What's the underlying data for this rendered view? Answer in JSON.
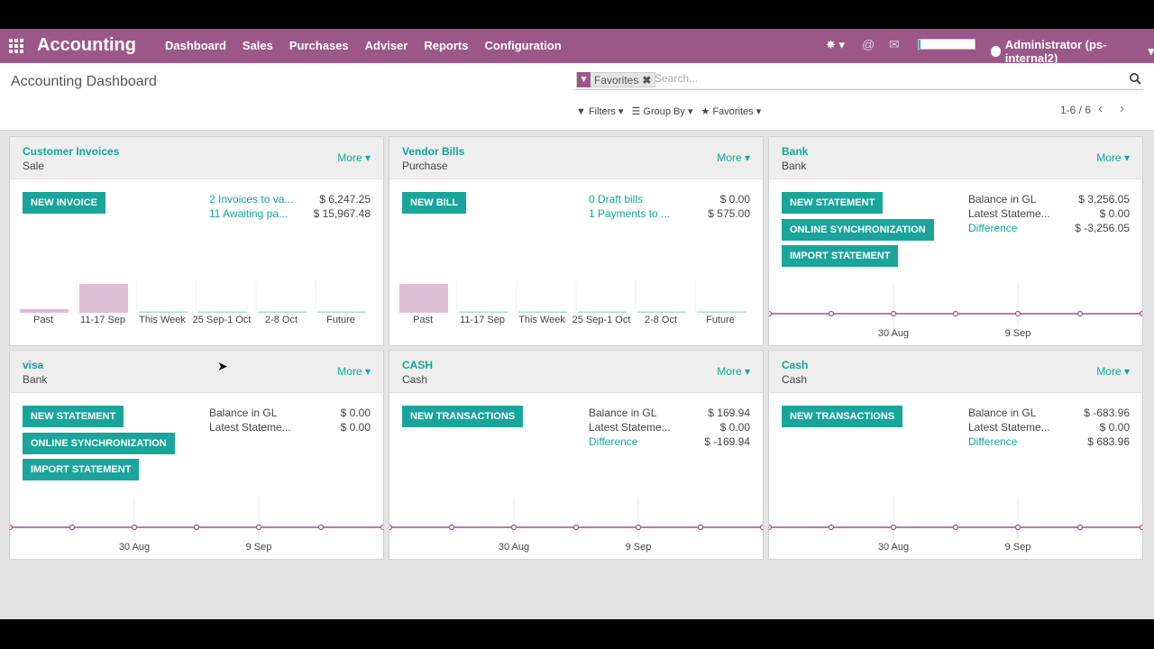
{
  "topbar": {
    "brand": "Accounting",
    "menu": [
      "Dashboard",
      "Sales",
      "Purchases",
      "Adviser",
      "Reports",
      "Configuration"
    ],
    "progress": 0.03,
    "user": "Administrator (ps-internal2)"
  },
  "control_panel": {
    "breadcrumb": "Accounting Dashboard",
    "facet": "Favorites",
    "search_placeholder": "Search...",
    "filters": "Filters",
    "group_by": "Group By",
    "favorites": "Favorites",
    "pager": "1-6 / 6"
  },
  "colors": {
    "brand": "#9c5789",
    "accent": "#1aa59a",
    "bar": "#ddbdd5",
    "line": "#9c5789"
  },
  "cards": [
    {
      "title": "Customer Invoices",
      "subtitle": "Sale",
      "more": "More",
      "buttons": [
        "NEW INVOICE"
      ],
      "stats": [
        {
          "label": "2 Invoices to va...",
          "value": "$ 6,247.25",
          "link": true
        },
        {
          "label": "11 Awaiting pa...",
          "value": "$ 15,967.48",
          "link": true
        }
      ],
      "chart": {
        "type": "bar",
        "categories": [
          "Past",
          "11-17 Sep",
          "This Week",
          "25 Sep-1 Oct",
          "2-8 Oct",
          "Future"
        ],
        "values": [
          0.13,
          1,
          0,
          0,
          0,
          0
        ]
      }
    },
    {
      "title": "Vendor Bills",
      "subtitle": "Purchase",
      "more": "More",
      "buttons": [
        "NEW BILL"
      ],
      "stats": [
        {
          "label": "0 Draft bills",
          "value": "$ 0.00",
          "link": true
        },
        {
          "label": "1 Payments to ...",
          "value": "$ 575.00",
          "link": true
        }
      ],
      "chart": {
        "type": "bar",
        "categories": [
          "Past",
          "11-17 Sep",
          "This Week",
          "25 Sep-1 Oct",
          "2-8 Oct",
          "Future"
        ],
        "values": [
          1,
          0,
          0,
          0,
          0,
          0
        ]
      }
    },
    {
      "title": "Bank",
      "subtitle": "Bank",
      "more": "More",
      "buttons": [
        "NEW STATEMENT",
        "ONLINE SYNCHRONIZATION",
        "IMPORT STATEMENT"
      ],
      "stats": [
        {
          "label": "Balance in GL",
          "value": "$ 3,256.05",
          "link": false
        },
        {
          "label": "Latest Stateme...",
          "value": "$ 0.00",
          "link": false
        },
        {
          "label": "Difference",
          "value": "$ -3,256.05",
          "link": true
        }
      ],
      "chart": {
        "type": "line",
        "ticks": [
          "30 Aug",
          "9 Sep"
        ]
      }
    },
    {
      "title": "visa",
      "subtitle": "Bank",
      "more": "More",
      "buttons": [
        "NEW STATEMENT",
        "ONLINE SYNCHRONIZATION",
        "IMPORT STATEMENT"
      ],
      "stats": [
        {
          "label": "Balance in GL",
          "value": "$ 0.00",
          "link": false
        },
        {
          "label": "Latest Stateme...",
          "value": "$ 0.00",
          "link": false
        }
      ],
      "chart": {
        "type": "line",
        "ticks": [
          "30 Aug",
          "9 Sep"
        ]
      }
    },
    {
      "title": "CASH",
      "subtitle": "Cash",
      "more": "More",
      "buttons": [
        "NEW TRANSACTIONS"
      ],
      "stats": [
        {
          "label": "Balance in GL",
          "value": "$ 169.94",
          "link": false
        },
        {
          "label": "Latest Stateme...",
          "value": "$ 0.00",
          "link": false
        },
        {
          "label": "Difference",
          "value": "$ -169.94",
          "link": true
        }
      ],
      "chart": {
        "type": "line",
        "ticks": [
          "30 Aug",
          "9 Sep"
        ]
      }
    },
    {
      "title": "Cash",
      "subtitle": "Cash",
      "more": "More",
      "buttons": [
        "NEW TRANSACTIONS"
      ],
      "stats": [
        {
          "label": "Balance in GL",
          "value": "$ -683.96",
          "link": false
        },
        {
          "label": "Latest Stateme...",
          "value": "$ 0.00",
          "link": false
        },
        {
          "label": "Difference",
          "value": "$ 683.96",
          "link": true
        }
      ],
      "chart": {
        "type": "line",
        "ticks": [
          "30 Aug",
          "9 Sep"
        ]
      }
    }
  ]
}
